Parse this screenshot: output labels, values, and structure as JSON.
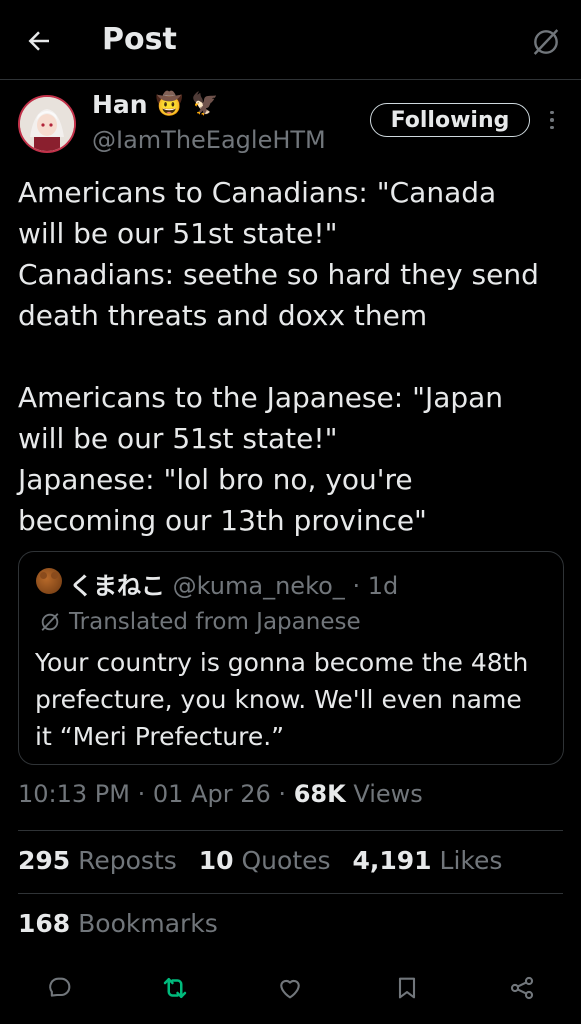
{
  "header": {
    "title": "Post",
    "back_icon": "back-arrow-icon",
    "right_icon": "grok-icon"
  },
  "author": {
    "name": "Han",
    "emoji_1": "🤠",
    "emoji_2": "🦅",
    "handle": "@IamTheEagleHTM",
    "follow_label": "Following"
  },
  "post": {
    "lines_1": [
      "Americans to Canadians: \"Canada",
      "will be our 51st state!\"",
      "Canadians: seethe so hard they send",
      "death threats and doxx them"
    ],
    "lines_2": [
      "Americans to the Japanese: \"Japan",
      "will be our 51st state!\"",
      "Japanese: \"lol bro no, you're",
      "becoming our 13th province\""
    ]
  },
  "quote": {
    "name": "くまねこ",
    "handle": "@kuma_neko_",
    "separator": "·",
    "age": "1d",
    "translated_label": "Translated from Japanese",
    "lines": [
      "Your country is gonna become the 48th",
      "prefecture, you know. We'll even name",
      "it “Meri Prefecture.”"
    ]
  },
  "meta": {
    "time": "10:13 PM",
    "sep": "·",
    "date": "01 Apr 26",
    "views_count": "68K",
    "views_label": "Views"
  },
  "stats": {
    "reposts_count": "295",
    "reposts_label": "Reposts",
    "quotes_count": "10",
    "quotes_label": "Quotes",
    "likes_count": "4,191",
    "likes_label": "Likes",
    "bookmarks_count": "168",
    "bookmarks_label": "Bookmarks"
  },
  "colors": {
    "background": "#000000",
    "text": "#e7e9ea",
    "muted": "#71767b",
    "border": "#2f3336",
    "repost_accent": "#00ba7c"
  }
}
